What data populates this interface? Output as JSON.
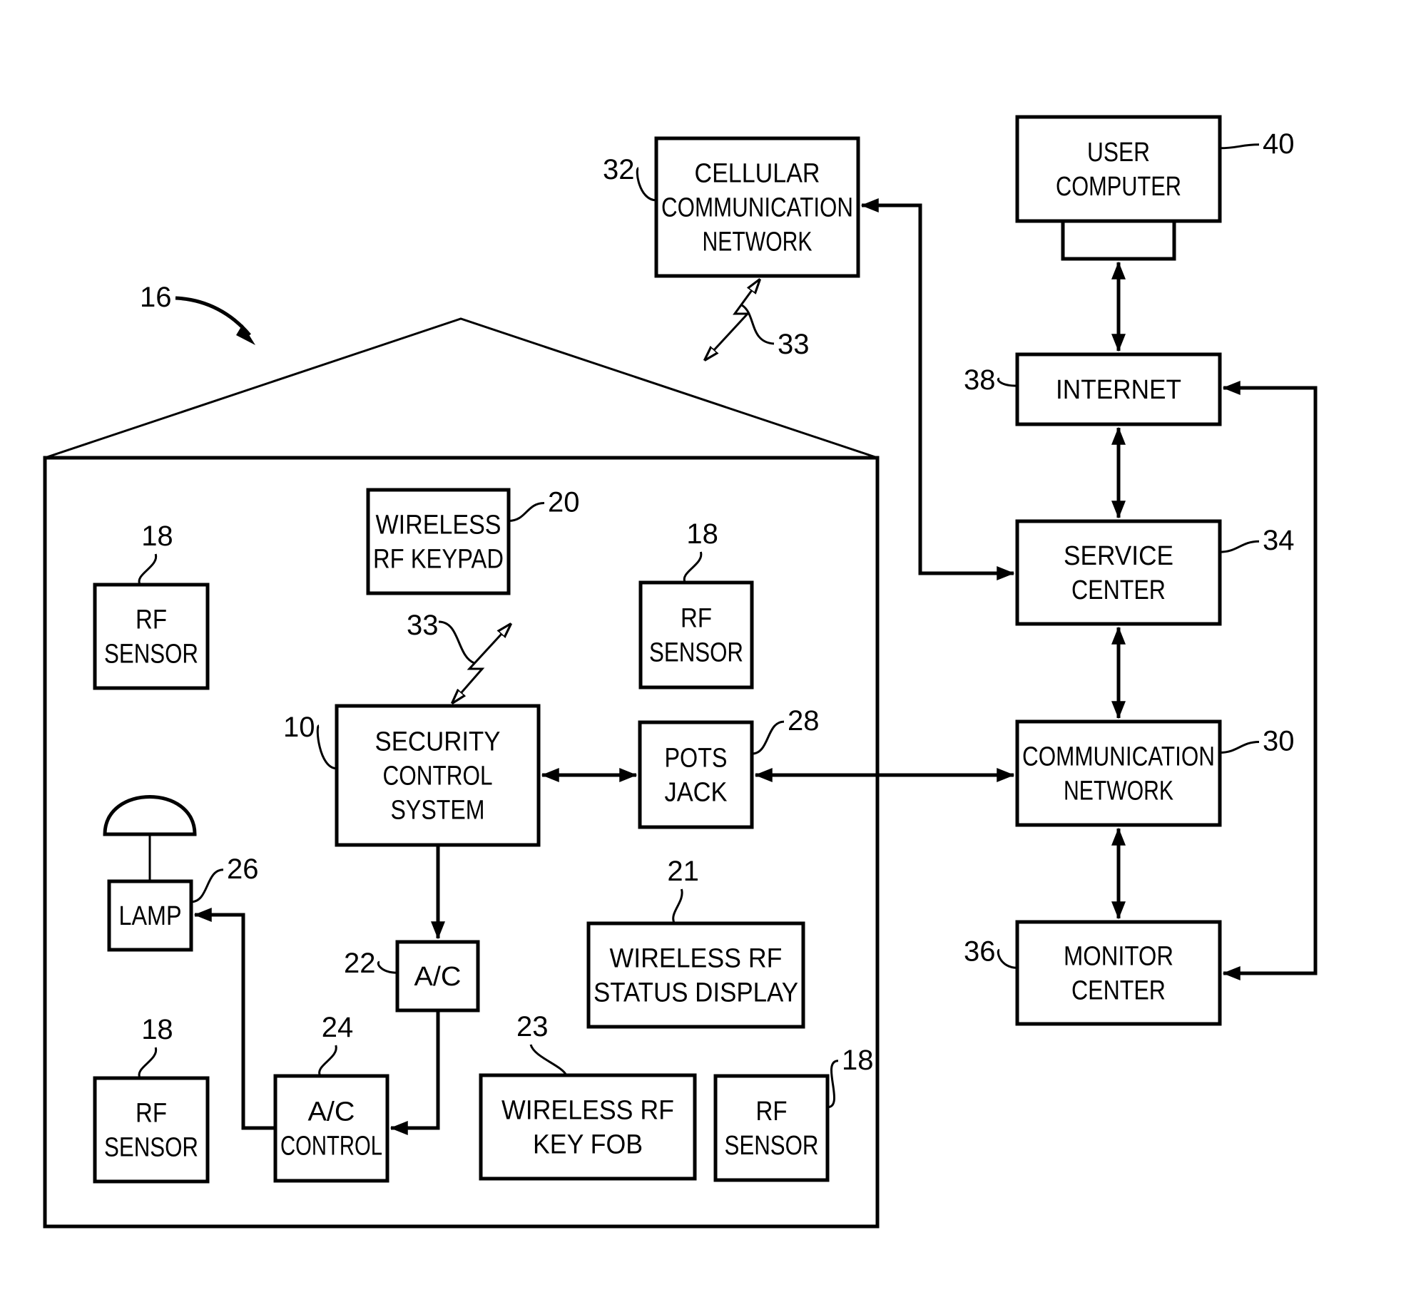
{
  "figure": {
    "house_ref": "16",
    "blocks": [
      {
        "id": "user-computer",
        "ref": "40",
        "lines": [
          "USER",
          "COMPUTER"
        ]
      },
      {
        "id": "internet",
        "ref": "38",
        "lines": [
          "INTERNET"
        ]
      },
      {
        "id": "service-center",
        "ref": "34",
        "lines": [
          "SERVICE",
          "CENTER"
        ]
      },
      {
        "id": "communication-network",
        "ref": "30",
        "lines": [
          "COMMUNICATION",
          "NETWORK"
        ]
      },
      {
        "id": "monitor-center",
        "ref": "36",
        "lines": [
          "MONITOR",
          "CENTER"
        ]
      },
      {
        "id": "cellular-network",
        "ref": "32",
        "lines": [
          "CELLULAR",
          "COMMUNICATION",
          "NETWORK"
        ]
      },
      {
        "id": "wireless-keypad",
        "ref": "20",
        "lines": [
          "WIRELESS",
          "RF KEYPAD"
        ]
      },
      {
        "id": "rf-sensor-top-left",
        "ref": "18",
        "lines": [
          "RF",
          "SENSOR"
        ]
      },
      {
        "id": "rf-sensor-top-right",
        "ref": "18",
        "lines": [
          "RF",
          "SENSOR"
        ]
      },
      {
        "id": "security-control-system",
        "ref": "10",
        "lines": [
          "SECURITY",
          "CONTROL",
          "SYSTEM"
        ]
      },
      {
        "id": "pots-jack",
        "ref": "28",
        "lines": [
          "POTS",
          "JACK"
        ]
      },
      {
        "id": "lamp",
        "ref": "26",
        "lines": [
          "LAMP"
        ]
      },
      {
        "id": "ac",
        "ref": "22",
        "lines": [
          "A/C"
        ]
      },
      {
        "id": "status-display",
        "ref": "21",
        "lines": [
          "WIRELESS RF",
          "STATUS DISPLAY"
        ]
      },
      {
        "id": "rf-sensor-bottom-left",
        "ref": "18",
        "lines": [
          "RF",
          "SENSOR"
        ]
      },
      {
        "id": "ac-control",
        "ref": "24",
        "lines": [
          "A/C",
          "CONTROL"
        ]
      },
      {
        "id": "key-fob",
        "ref": "23",
        "lines": [
          "WIRELESS RF",
          "KEY FOB"
        ]
      },
      {
        "id": "rf-sensor-bottom-right",
        "ref": "18",
        "lines": [
          "RF",
          "SENSOR"
        ]
      }
    ],
    "wireless_link_ref": "33"
  }
}
